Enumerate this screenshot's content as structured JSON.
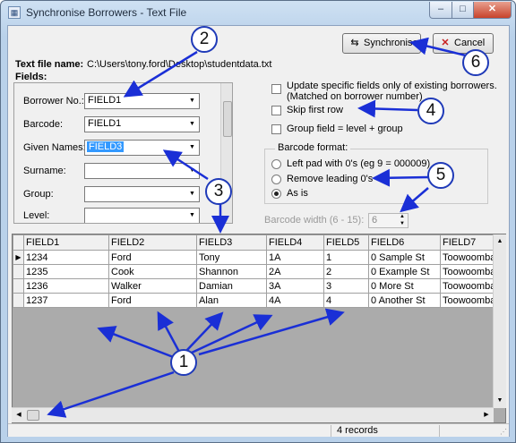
{
  "window": {
    "title": "Synchronise Borrowers - Text File",
    "minimize": "–",
    "maximize": "□",
    "close": "✕"
  },
  "toolbar": {
    "sync_label": "Synchronise",
    "cancel_label": "Cancel",
    "sync_icon": "sync-icon",
    "cancel_icon": "x-icon"
  },
  "file": {
    "label": "Text file name:",
    "path": "C:\\Users\\tony.ford\\Desktop\\studentdata.txt"
  },
  "fields": {
    "heading": "Fields:",
    "rows": [
      {
        "label": "Borrower No.:",
        "value": "FIELD1",
        "selected": false
      },
      {
        "label": "Barcode:",
        "value": "FIELD1",
        "selected": false
      },
      {
        "label": "Given Names:",
        "value": "FIELD3",
        "selected": true
      },
      {
        "label": "Surname:",
        "value": "",
        "selected": false
      },
      {
        "label": "Group:",
        "value": "",
        "selected": false
      },
      {
        "label": "Level:",
        "value": "",
        "selected": false
      }
    ]
  },
  "options": {
    "update_specific_line1": "Update specific fields only of existing borrowers.",
    "update_specific_line2": "(Matched on borrower number)",
    "skip_first_row": "Skip first row",
    "group_field": "Group field = level + group"
  },
  "barcode": {
    "title": "Barcode format:",
    "left_pad": "Left pad with 0's (eg 9 = 000009)",
    "remove_leading": "Remove leading 0's",
    "as_is": "As is",
    "selected": "As is",
    "width_label": "Barcode width (6 - 15):",
    "width_value": "6"
  },
  "grid": {
    "columns": [
      "FIELD1",
      "FIELD2",
      "FIELD3",
      "FIELD4",
      "FIELD5",
      "FIELD6",
      "FIELD7"
    ],
    "rows": [
      [
        "1234",
        "Ford",
        "Tony",
        "1A",
        "1",
        "0 Sample St",
        "Toowoomba"
      ],
      [
        "1235",
        "Cook",
        "Shannon",
        "2A",
        "2",
        "0 Example St",
        "Toowoomba"
      ],
      [
        "1236",
        "Walker",
        "Damian",
        "3A",
        "3",
        "0 More St",
        "Toowoomba"
      ],
      [
        "1237",
        "Ford",
        "Alan",
        "4A",
        "4",
        "0 Another St",
        "Toowoomba"
      ]
    ]
  },
  "status": {
    "records": "4 records"
  },
  "callouts": [
    "1",
    "2",
    "3",
    "4",
    "5",
    "6"
  ],
  "colors": {
    "callout_border": "#1f3ab8",
    "arrow": "#1a2fd6",
    "selection": "#3399ff"
  }
}
